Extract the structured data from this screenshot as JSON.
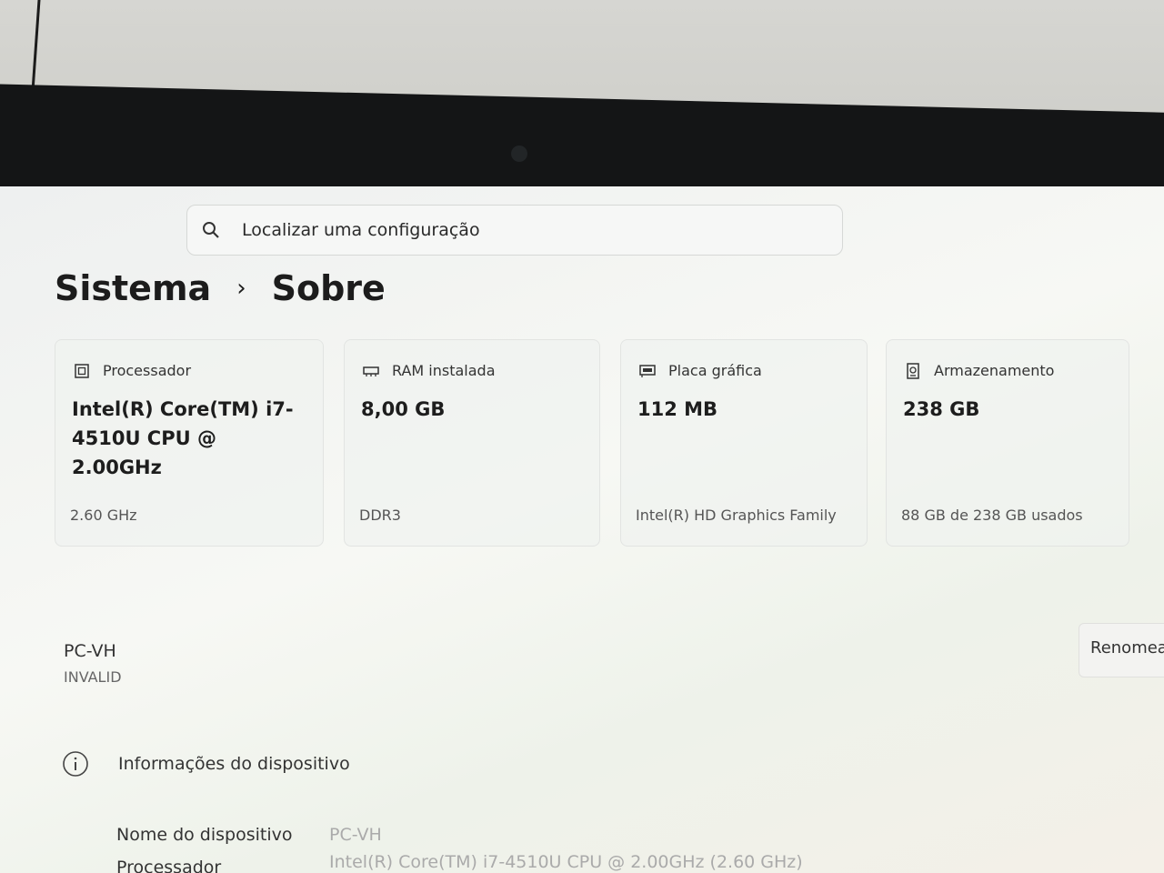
{
  "search": {
    "placeholder": "Localizar uma configuração"
  },
  "breadcrumb": {
    "parent": "Sistema",
    "separator": "›",
    "current": "Sobre"
  },
  "cards": [
    {
      "icon": "processor-icon",
      "label": "Processador",
      "value": "Intel(R) Core(TM) i7-4510U CPU @ 2.00GHz",
      "footer": "2.60 GHz"
    },
    {
      "icon": "ram-icon",
      "label": "RAM instalada",
      "value": "8,00 GB",
      "footer": "DDR3"
    },
    {
      "icon": "gpu-icon",
      "label": "Placa gráfica",
      "value": "112 MB",
      "footer": "Intel(R) HD Graphics Family"
    },
    {
      "icon": "storage-icon",
      "label": "Armazenamento",
      "value": "238 GB",
      "footer": "88 GB de 238 GB usados"
    }
  ],
  "device": {
    "name": "PC-VH",
    "status": "INVALID",
    "rename_label": "Renomea"
  },
  "device_info": {
    "title": "Informações do dispositivo",
    "rows": [
      {
        "label": "Nome do dispositivo",
        "value": "PC-VH"
      },
      {
        "label": "Processador",
        "value": "Intel(R) Core(TM) i7-4510U CPU @ 2.00GHz (2.60 GHz)"
      }
    ]
  }
}
